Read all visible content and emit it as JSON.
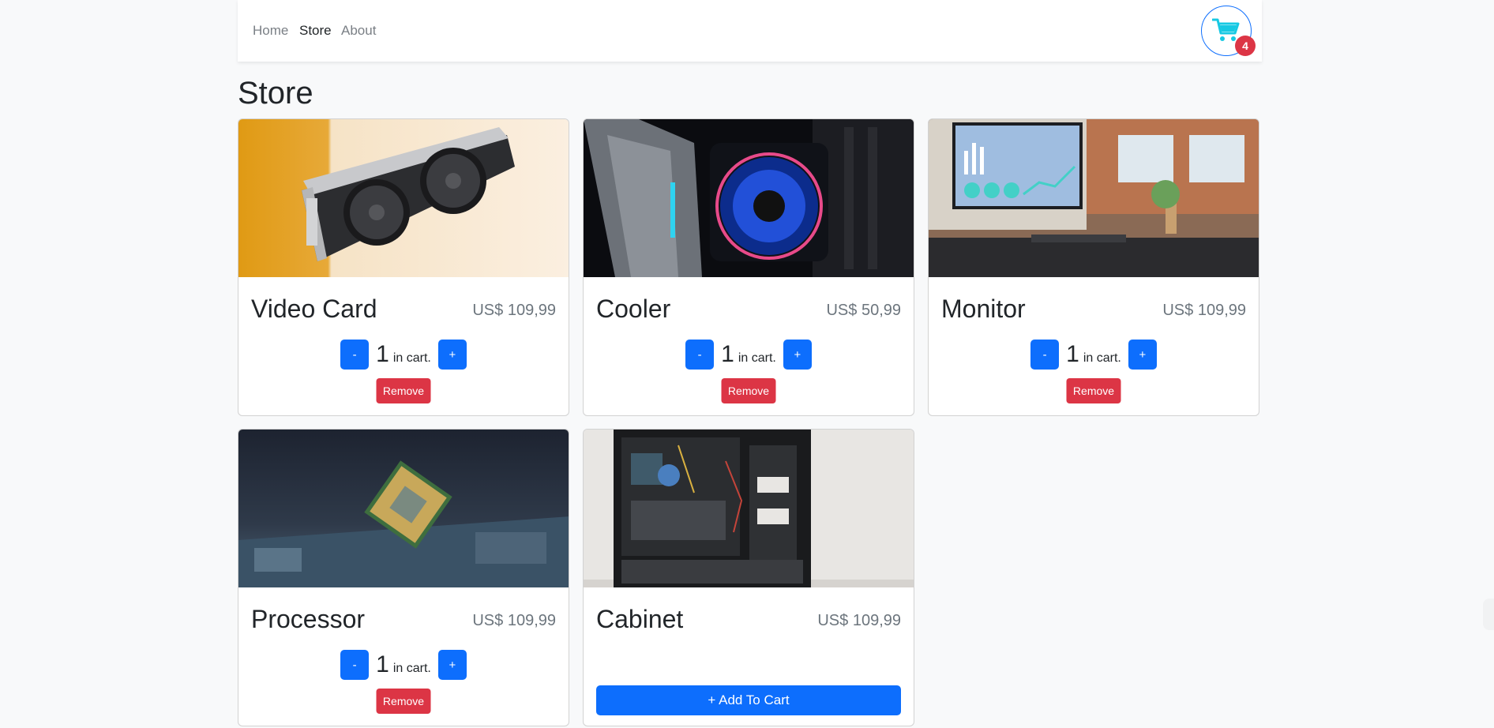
{
  "nav": {
    "items": [
      {
        "label": "Home"
      },
      {
        "label": "Store"
      },
      {
        "label": "About"
      }
    ],
    "cart_count": "4",
    "cart_icon": "shopping-cart-icon"
  },
  "page_title": "Store",
  "products": [
    {
      "name": "Video Card",
      "price": "US$ 109,99",
      "quantity": "1",
      "in_cart_label": "in cart.",
      "decrease_label": "-",
      "increase_label": "+",
      "remove_label": "Remove"
    },
    {
      "name": "Cooler",
      "price": "US$ 50,99",
      "quantity": "1",
      "in_cart_label": "in cart.",
      "decrease_label": "-",
      "increase_label": "+",
      "remove_label": "Remove"
    },
    {
      "name": "Monitor",
      "price": "US$ 109,99",
      "quantity": "1",
      "in_cart_label": "in cart.",
      "decrease_label": "-",
      "increase_label": "+",
      "remove_label": "Remove"
    },
    {
      "name": "Processor",
      "price": "US$ 109,99",
      "quantity": "1",
      "in_cart_label": "in cart.",
      "decrease_label": "-",
      "increase_label": "+",
      "remove_label": "Remove"
    },
    {
      "name": "Cabinet",
      "price": "US$ 109,99",
      "add_label": "+ Add To Cart"
    }
  ],
  "colors": {
    "primary": "#0d6efd",
    "danger": "#dc3545",
    "background": "#f8f9fa",
    "cart_icon": "#17c9e3"
  }
}
